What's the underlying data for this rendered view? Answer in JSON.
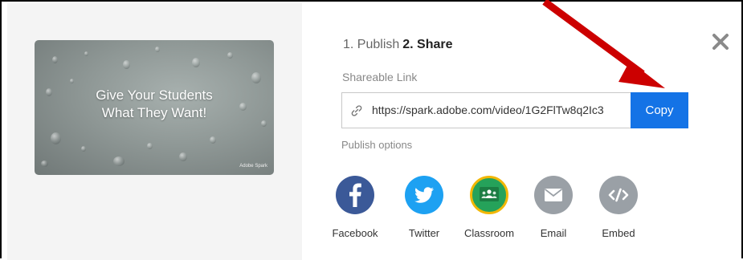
{
  "steps": {
    "step1": "1. Publish",
    "step2": "2. Share"
  },
  "close_icon": "close-x-icon",
  "thumbnail": {
    "line1": "Give Your Students",
    "line2": "What They Want!",
    "badge": "Adobe Spark"
  },
  "shareable_link": {
    "label": "Shareable Link",
    "url": "https://spark.adobe.com/video/1G2FlTw8q2Ic3",
    "icon": "link-icon",
    "copy_label": "Copy"
  },
  "publish_options_label": "Publish options",
  "share_targets": [
    {
      "label": "Facebook",
      "icon": "facebook-icon",
      "color": "#3b5998"
    },
    {
      "label": "Twitter",
      "icon": "twitter-icon",
      "color": "#1da1f2"
    },
    {
      "label": "Classroom",
      "icon": "classroom-icon",
      "color": "#25a25a"
    },
    {
      "label": "Email",
      "icon": "email-icon",
      "color": "#9aa0a6"
    },
    {
      "label": "Embed",
      "icon": "embed-icon",
      "color": "#9aa0a6"
    }
  ],
  "colors": {
    "accent": "#1473e6",
    "annotation_arrow": "#cc0000"
  }
}
